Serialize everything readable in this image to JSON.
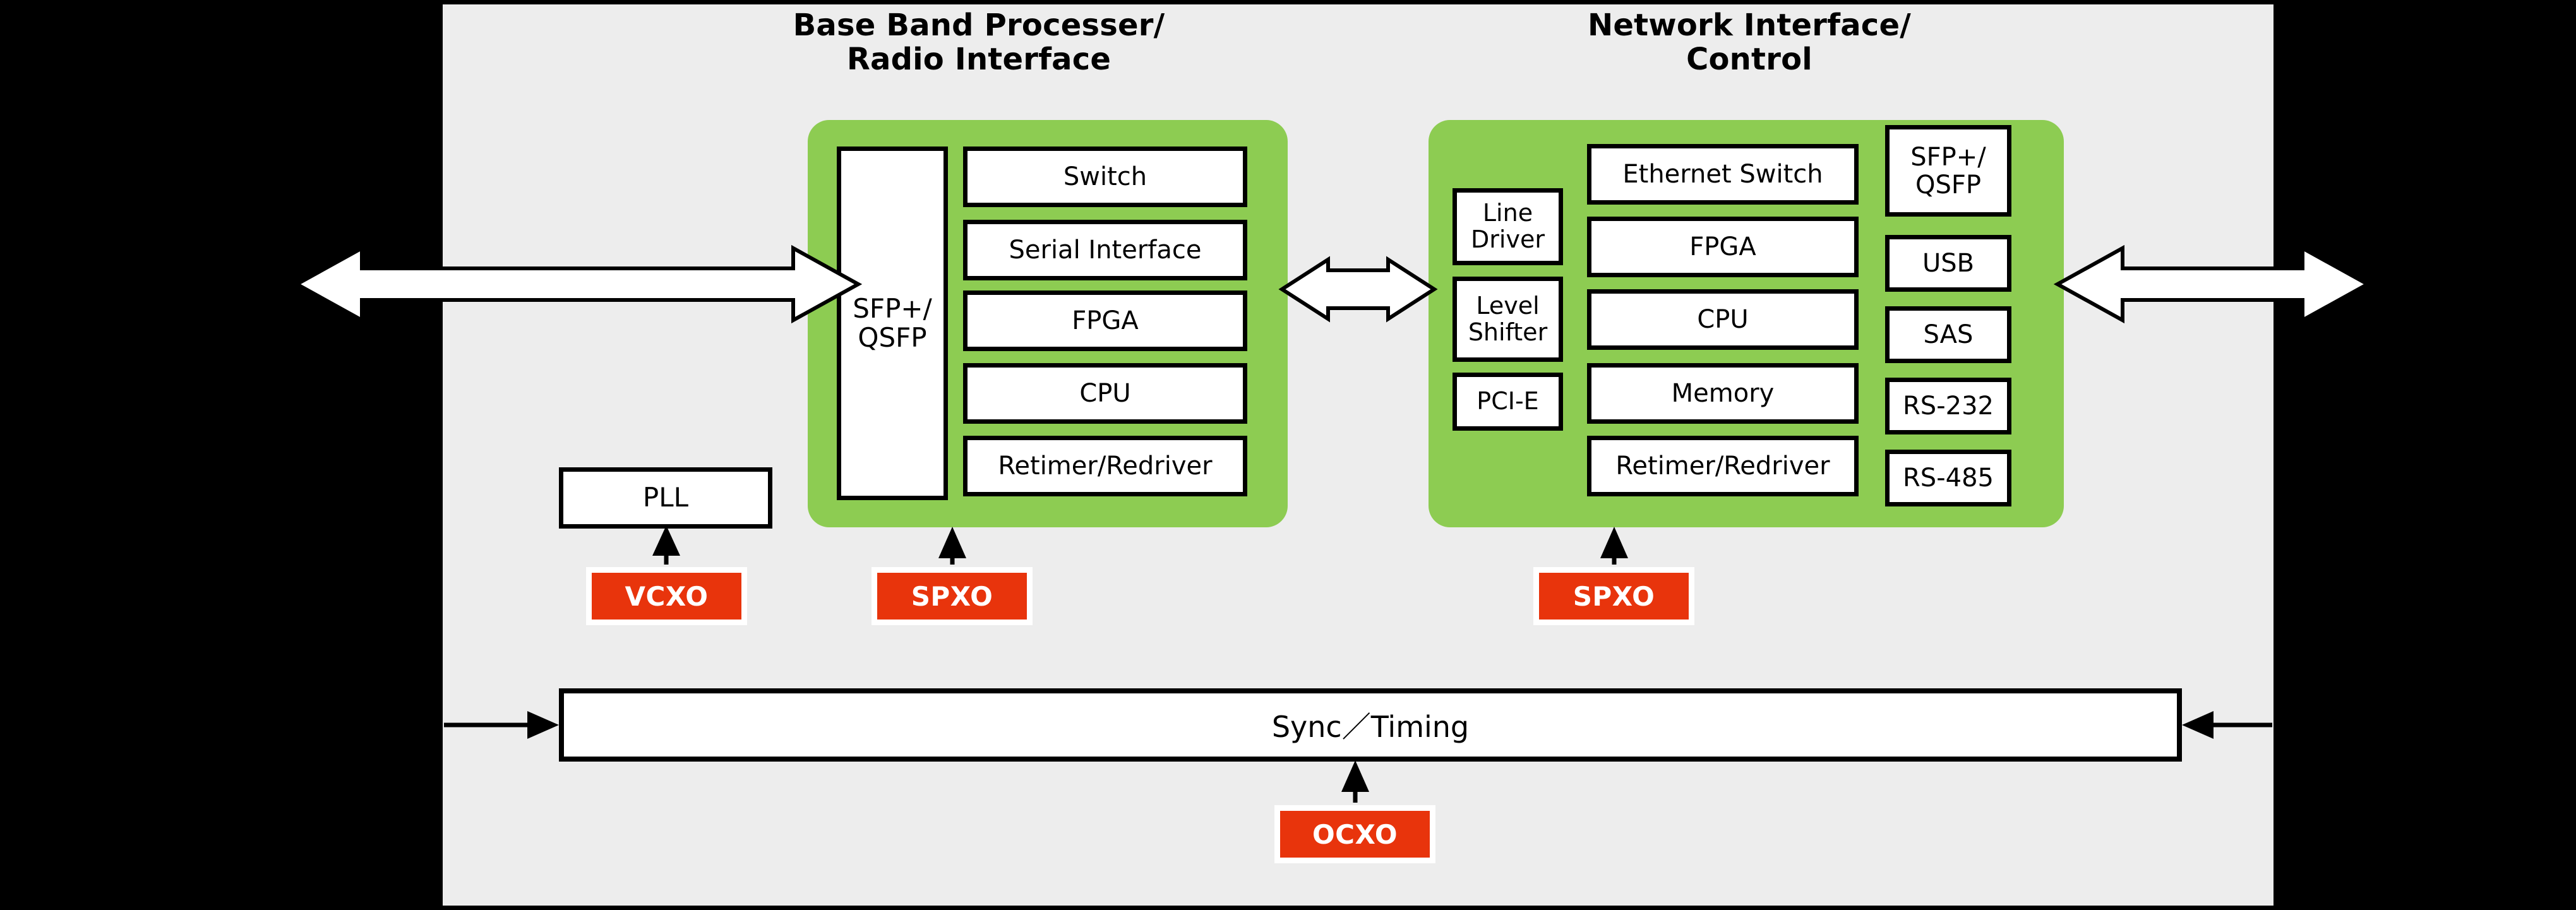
{
  "colors": {
    "background": "#000000",
    "panel": "#ededed",
    "group_green": "#8dcc52",
    "oscillator_orange": "#e8340c",
    "box_fill": "#ffffff",
    "stroke": "#000000"
  },
  "sections": {
    "baseband": {
      "title": "Base Band Processer/\nRadio Interface",
      "connector_box": {
        "label": "SFP+/\nQSFP"
      },
      "blocks": [
        {
          "label": "Switch"
        },
        {
          "label": "Serial Interface"
        },
        {
          "label": "FPGA"
        },
        {
          "label": "CPU"
        },
        {
          "label": "Retimer/Redriver"
        }
      ]
    },
    "network": {
      "title": "Network Interface/\nControl",
      "left_column": [
        {
          "label": "Line\nDriver"
        },
        {
          "label": "Level\nShifter"
        },
        {
          "label": "PCI-E"
        }
      ],
      "center_column": [
        {
          "label": "Ethernet Switch"
        },
        {
          "label": "FPGA"
        },
        {
          "label": "CPU"
        },
        {
          "label": "Memory"
        },
        {
          "label": "Retimer/Redriver"
        }
      ],
      "right_column": [
        {
          "label": "SFP+/\nQSFP"
        },
        {
          "label": "USB"
        },
        {
          "label": "SAS"
        },
        {
          "label": "RS-232"
        },
        {
          "label": "RS-485"
        }
      ]
    }
  },
  "pll": {
    "label": "PLL"
  },
  "oscillators": [
    {
      "label": "VCXO"
    },
    {
      "label": "SPXO"
    },
    {
      "label": "SPXO"
    },
    {
      "label": "OCXO"
    }
  ],
  "sync_bar": {
    "label": "Sync／Timing"
  },
  "arrows": {
    "left_io": "bidirectional-block-arrow",
    "interconnect": "bidirectional-block-arrow",
    "right_io": "bidirectional-block-arrow",
    "vcxo_to_pll": "up-arrow",
    "spxo_to_baseband": "up-arrow",
    "spxo_to_network": "up-arrow",
    "ocxo_to_sync": "up-arrow",
    "sync_in_left": "right-arrow",
    "sync_in_right": "left-arrow"
  }
}
